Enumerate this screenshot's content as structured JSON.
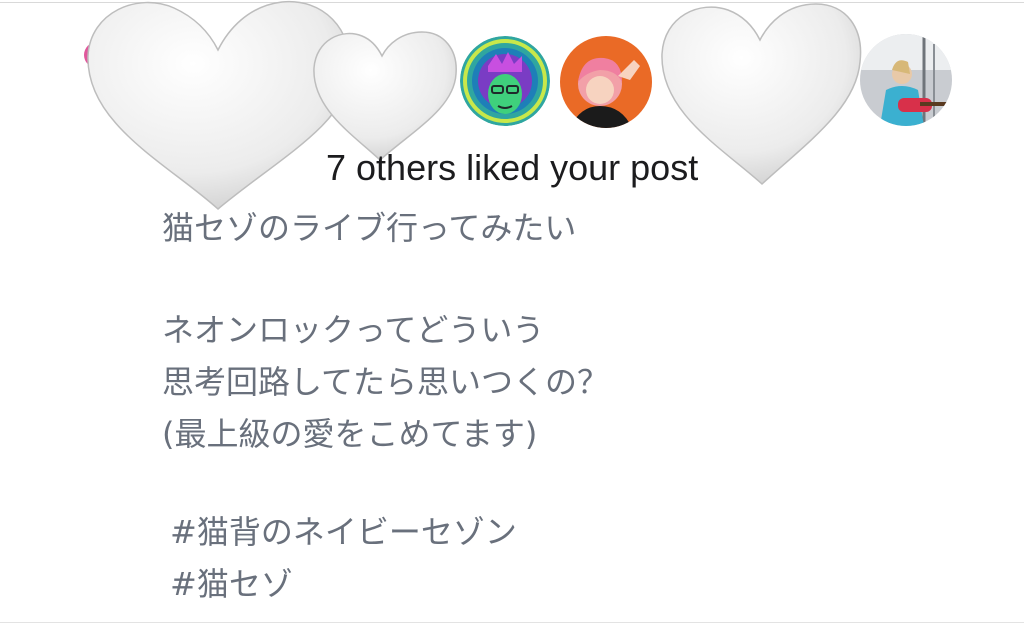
{
  "notification": {
    "liked_text": "7 others liked your post"
  },
  "post": {
    "lines": [
      "猫セゾのライブ行ってみたい",
      "ネオンロックってどういう",
      "思考回路してたら思いつくの？",
      "(最上級の愛をこめてます)"
    ],
    "hashtags": [
      "#猫背のネイビーセゾン",
      "#猫セゾ"
    ]
  },
  "avatars": [
    {
      "name": "neon-face-avatar",
      "accent": "#2a8f6a"
    },
    {
      "name": "orange-bg-avatar",
      "accent": "#e8621f"
    },
    {
      "name": "guitarist-avatar",
      "accent": "#33a5c8"
    }
  ],
  "overlays": {
    "heart_color": "#eeeeee",
    "heart_count": 3
  }
}
